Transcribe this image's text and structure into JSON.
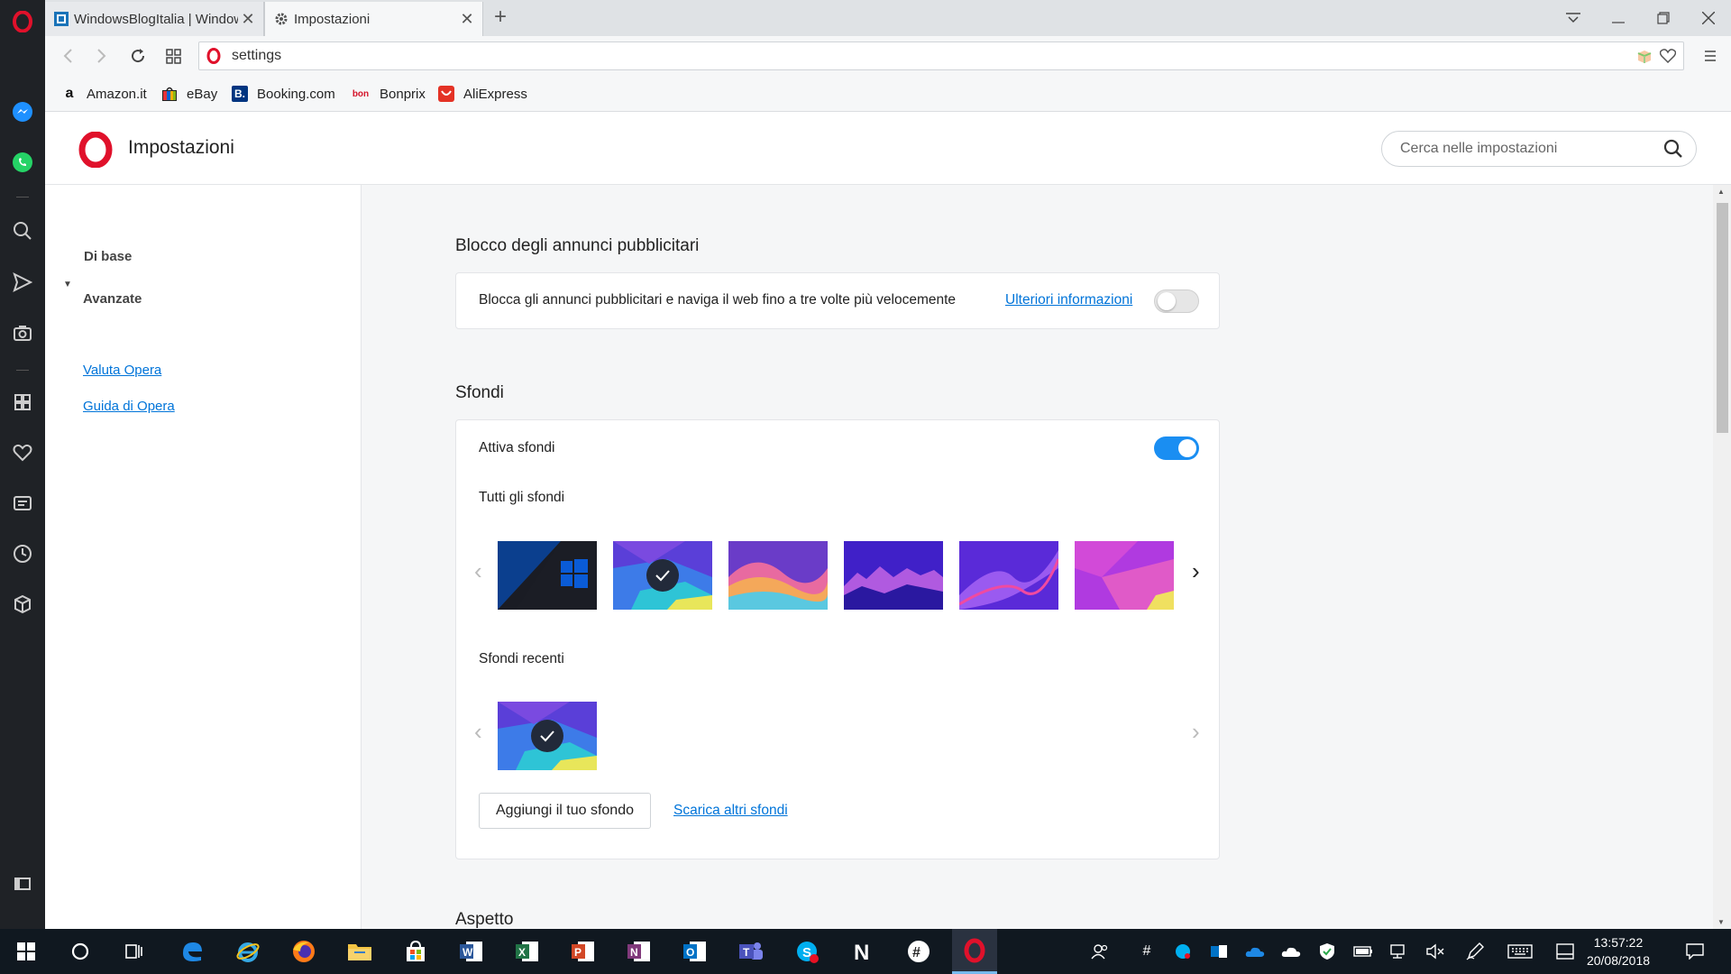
{
  "tabs": [
    {
      "title": "WindowsBlogItalia | Windows",
      "active": false
    },
    {
      "title": "Impostazioni",
      "active": true
    }
  ],
  "address": {
    "url": "settings"
  },
  "bookmarks": [
    {
      "label": "Amazon.it",
      "icon": "amazon-icon"
    },
    {
      "label": "eBay",
      "icon": "ebay-icon"
    },
    {
      "label": "Booking.com",
      "icon": "booking-icon"
    },
    {
      "label": "Bonprix",
      "icon": "bonprix-icon"
    },
    {
      "label": "AliExpress",
      "icon": "aliexpress-icon"
    }
  ],
  "settings": {
    "title": "Impostazioni",
    "search_placeholder": "Cerca nelle impostazioni",
    "nav": {
      "basic": "Di base",
      "advanced": "Avanzate",
      "rate": "Valuta Opera",
      "help": "Guida di Opera"
    }
  },
  "adblock": {
    "section_title": "Blocco degli annunci pubblicitari",
    "description": "Blocca gli annunci pubblicitari e naviga il web fino a tre volte più velocemente",
    "link": "Ulteriori informazioni",
    "enabled": false
  },
  "wallpapers": {
    "section_title": "Sfondi",
    "enable_label": "Attiva sfondi",
    "enabled": true,
    "all_label": "Tutti gli sfondi",
    "recent_label": "Sfondi recenti",
    "add_button": "Aggiungi il tuo sfondo",
    "more_link": "Scarica altri sfondi"
  },
  "next_section": "Aspetto",
  "taskbar": {
    "time": "13:57:22",
    "date": "20/08/2018"
  },
  "colors": {
    "accent": "#1a8ef2",
    "link": "#0074d9",
    "opera_red": "#e0112b"
  }
}
